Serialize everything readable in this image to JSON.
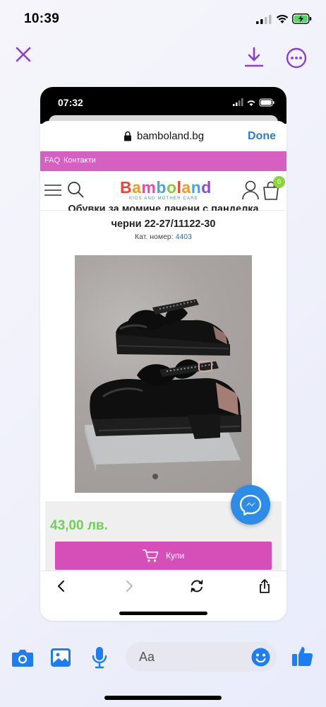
{
  "status_bar": {
    "time": "10:39",
    "signal_icon": "signal-icon",
    "wifi_icon": "wifi-icon",
    "battery_icon": "battery-charging-icon"
  },
  "viewer_toolbar": {
    "close_icon": "close-icon",
    "download_icon": "download-icon",
    "more_icon": "more-options-icon",
    "accent_color": "#8a3ed6"
  },
  "inner_screenshot": {
    "status_time": "07:32",
    "browser": {
      "url": "bamboland.bg",
      "done_label": "Done"
    },
    "top_links": [
      "FAQ",
      "Контакти"
    ],
    "header": {
      "logo_text": "Bamboland",
      "logo_tagline": "KIDS AND MOTHER CARE",
      "cart_count": "0"
    },
    "product": {
      "title_line1": "Обувки за момиче лачени с панделка",
      "title_line2": "черни 22-27/11122-30",
      "sku_label": "Кат. номер:",
      "sku_value": "4403",
      "price": "43,00 лв.",
      "buy_label": "Купи",
      "image_icon": "shoes-photo"
    },
    "colors": {
      "pink_bar": "#d65fc2",
      "price_green": "#6fd15a",
      "buy_button": "#d64fb8",
      "messenger_blue": "#2d8ce6"
    }
  },
  "messenger_bar": {
    "input_placeholder": "Aa",
    "camera_icon": "camera-icon",
    "gallery_icon": "gallery-icon",
    "mic_icon": "microphone-icon",
    "emoji_icon": "emoji-icon",
    "like_icon": "thumbs-up-icon",
    "accent_color": "#1e7df0"
  }
}
